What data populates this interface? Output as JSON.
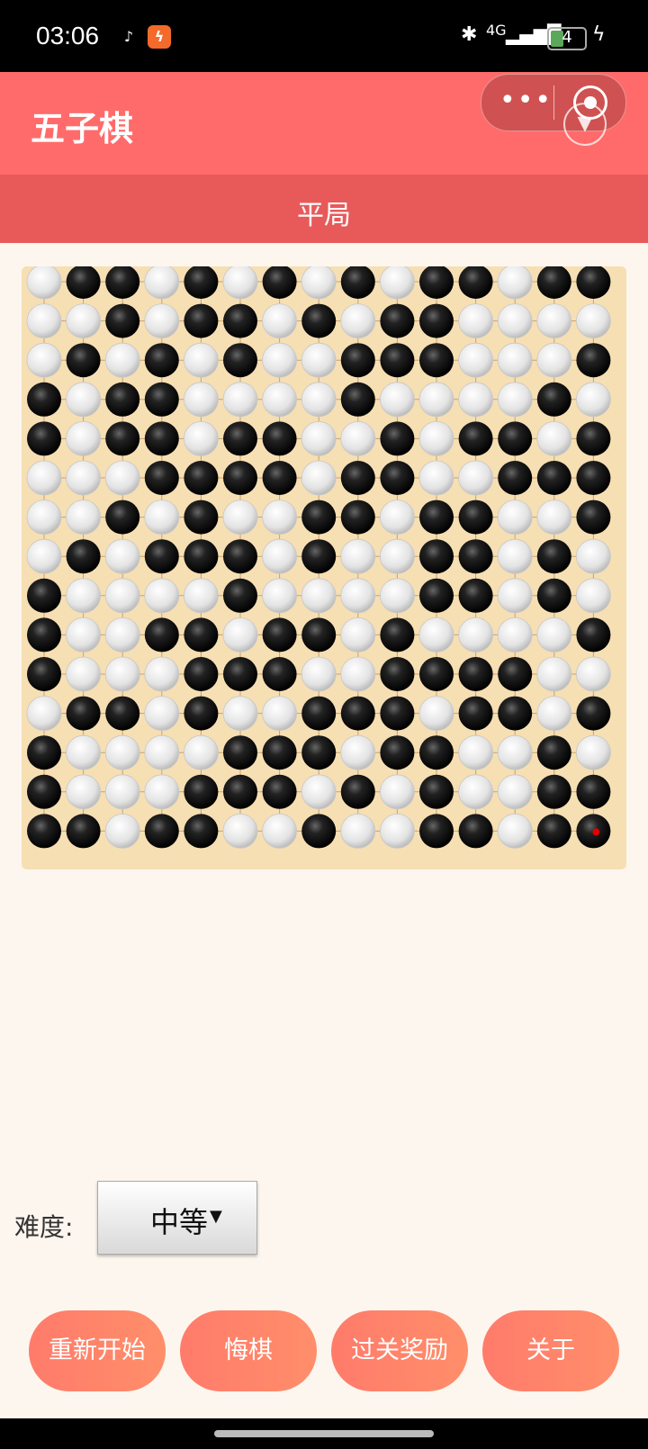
{
  "status_bar": {
    "time": "03:06",
    "apps": [
      "tiktok-icon",
      "flash-app-icon"
    ],
    "network": "4G",
    "battery": "4"
  },
  "title_bar": {
    "title": "五子棋",
    "capsule_more": "•••",
    "icons": [
      "more-icon",
      "target-icon",
      "chevron-down-icon"
    ]
  },
  "game": {
    "status_text": "平局"
  },
  "board": {
    "size": 15,
    "colors": {
      "board": "#f6dfb3",
      "line": "#c9a36b",
      "black": "#111111",
      "white": "#e8e8e8",
      "last_move": "#e00000"
    },
    "last_move": [
      14,
      14
    ],
    "rows": [
      "WBBWBWBWBWBBWBB",
      "WWBWBBWBWBBWWWW",
      "WBWBWBWWBBBWWWB",
      "BWBBWWWWBWWWWBW",
      "BWBBWBBWWBWBBWB",
      "WWWBBBBWBBWWBBB",
      "WWBWBWWBBWBBWWB",
      "WBWBBBWBWWBBWBW",
      "BWWWWBWWWWBBWBW",
      "BWWBBWBBWBWWWWB",
      "BWWWBBBWWBBBBWW",
      "WBBWBWWBBBWBBWB",
      "BWWWWBBBWBBWWBW",
      "BWWWBBBWBWBWWBB",
      "BBWBBWWBWWBBWBB"
    ]
  },
  "controls": {
    "difficulty_label": "难度:",
    "difficulty_value": "中等",
    "buttons": {
      "restart": "重新开始",
      "undo": "悔棋",
      "reward": "过关奖励",
      "about": "关于"
    }
  }
}
